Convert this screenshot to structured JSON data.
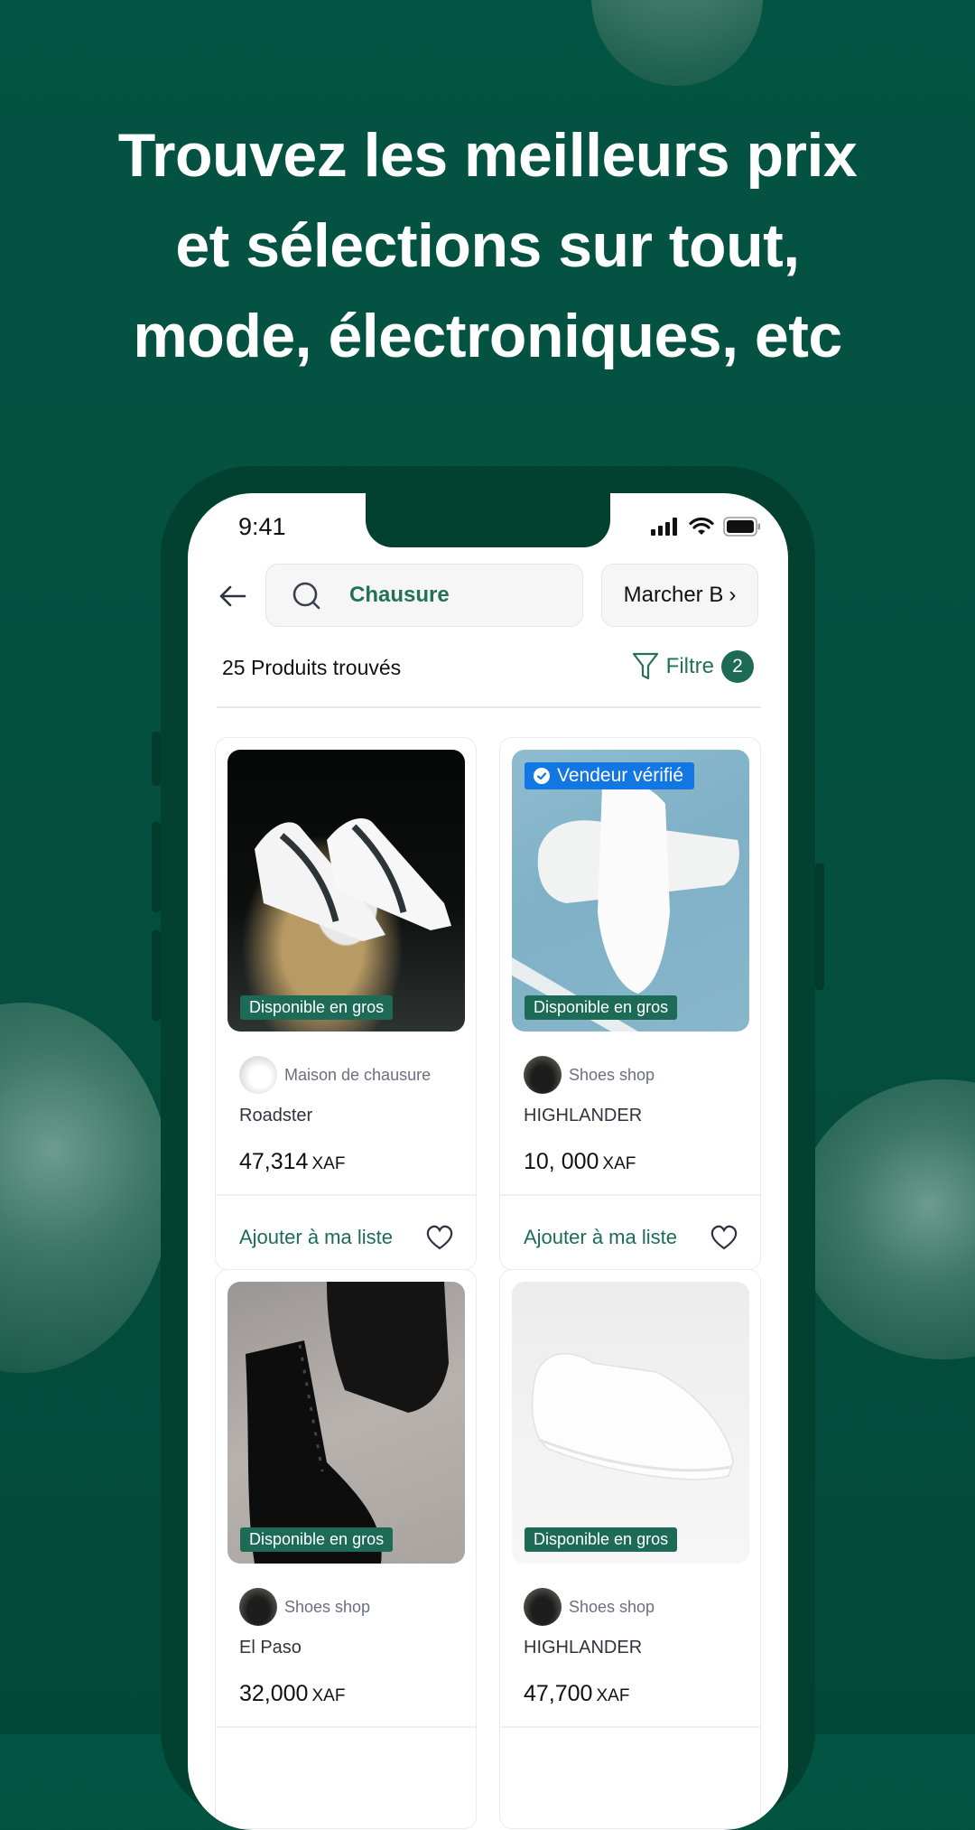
{
  "headline": {
    "line1": "Trouvez les meilleurs prix",
    "line2": "et sélections sur tout,",
    "line3": "mode, électroniques, etc"
  },
  "status_bar": {
    "time": "9:41",
    "icons": [
      "signal-icon",
      "wifi-icon",
      "battery-icon"
    ]
  },
  "search": {
    "back_icon": "arrow-left-icon",
    "search_icon": "search-icon",
    "query": "Chausure",
    "market_label": "Marcher B",
    "market_chevron": "›"
  },
  "results": {
    "count_label": "25 Produits trouvés",
    "filter_label": "Filtre",
    "filter_count": "2"
  },
  "colors": {
    "brand_green": "#1e6b55",
    "background_green": "#045443",
    "verified_blue": "#1276e3"
  },
  "products": [
    {
      "image": "white sneakers with dark stripes on rope",
      "bulk_tag": "Disponible en gros",
      "verified_tag": null,
      "seller": "Maison de chausure",
      "name": "Roadster",
      "price": "47,314",
      "currency": "XAF",
      "add_label": "Ajouter à ma liste"
    },
    {
      "image": "white sneakers on blue background",
      "bulk_tag": "Disponible en gros",
      "verified_tag": "Vendeur vérifié",
      "seller": "Shoes shop",
      "name": "HIGHLANDER",
      "price": "10, 000",
      "currency": "XAF",
      "add_label": "Ajouter à ma liste"
    },
    {
      "image": "black patent leather boots",
      "bulk_tag": "Disponible en gros",
      "verified_tag": null,
      "seller": "Shoes shop",
      "name": "El Paso",
      "price": "32,000",
      "currency": "XAF",
      "add_label": "Ajouter à ma liste"
    },
    {
      "image": "white low-top sneaker",
      "bulk_tag": "Disponible en gros",
      "verified_tag": null,
      "seller": "Shoes shop",
      "name": "HIGHLANDER",
      "price": "47,700",
      "currency": "XAF",
      "add_label": "Ajouter à ma liste"
    }
  ]
}
